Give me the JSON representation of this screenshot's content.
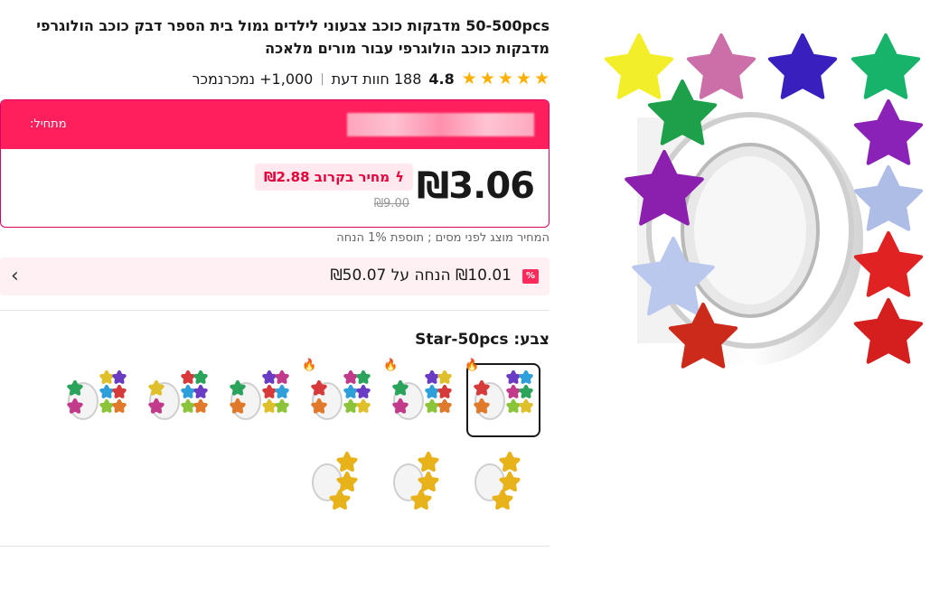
{
  "product": {
    "title": "50-500pcs מדבקות כוכב צבעוני לילדים גמול בית הספר דבק כוכב הולוגרפי מדבקות כוכב הולוגרפי עבור מורים מלאכה",
    "rating": "4.8",
    "reviews": "188 חוות דעת",
    "sold": "1,000+ נמכרנמכר"
  },
  "price": {
    "start_label": "מתחיל:",
    "current": "₪3.06",
    "original": "₪9.00",
    "soon_label": "מחיר בקרוב ₪2.88",
    "tax_note": "המחיר מוצג לפני מסים ; תוספת 1% הנחה"
  },
  "discount": {
    "badge": "%",
    "text": "₪10.01 הנחה על ₪50.07"
  },
  "color": {
    "label": "צבע: Star-50pcs"
  },
  "variants": [
    {
      "name": "Star-50pcs",
      "fire": true,
      "selected": true
    },
    {
      "name": "variant-2",
      "fire": true,
      "selected": false
    },
    {
      "name": "variant-3",
      "fire": true,
      "selected": false
    },
    {
      "name": "variant-4",
      "fire": false,
      "selected": false
    },
    {
      "name": "variant-5",
      "fire": false,
      "selected": false
    },
    {
      "name": "variant-6",
      "fire": false,
      "selected": false
    },
    {
      "name": "variant-7",
      "fire": false,
      "selected": false
    },
    {
      "name": "variant-8",
      "fire": false,
      "selected": false
    },
    {
      "name": "variant-9",
      "fire": false,
      "selected": false
    }
  ],
  "colors": {
    "accent": "#fe1f5c",
    "star": "#fdb000",
    "text": "#191919"
  }
}
